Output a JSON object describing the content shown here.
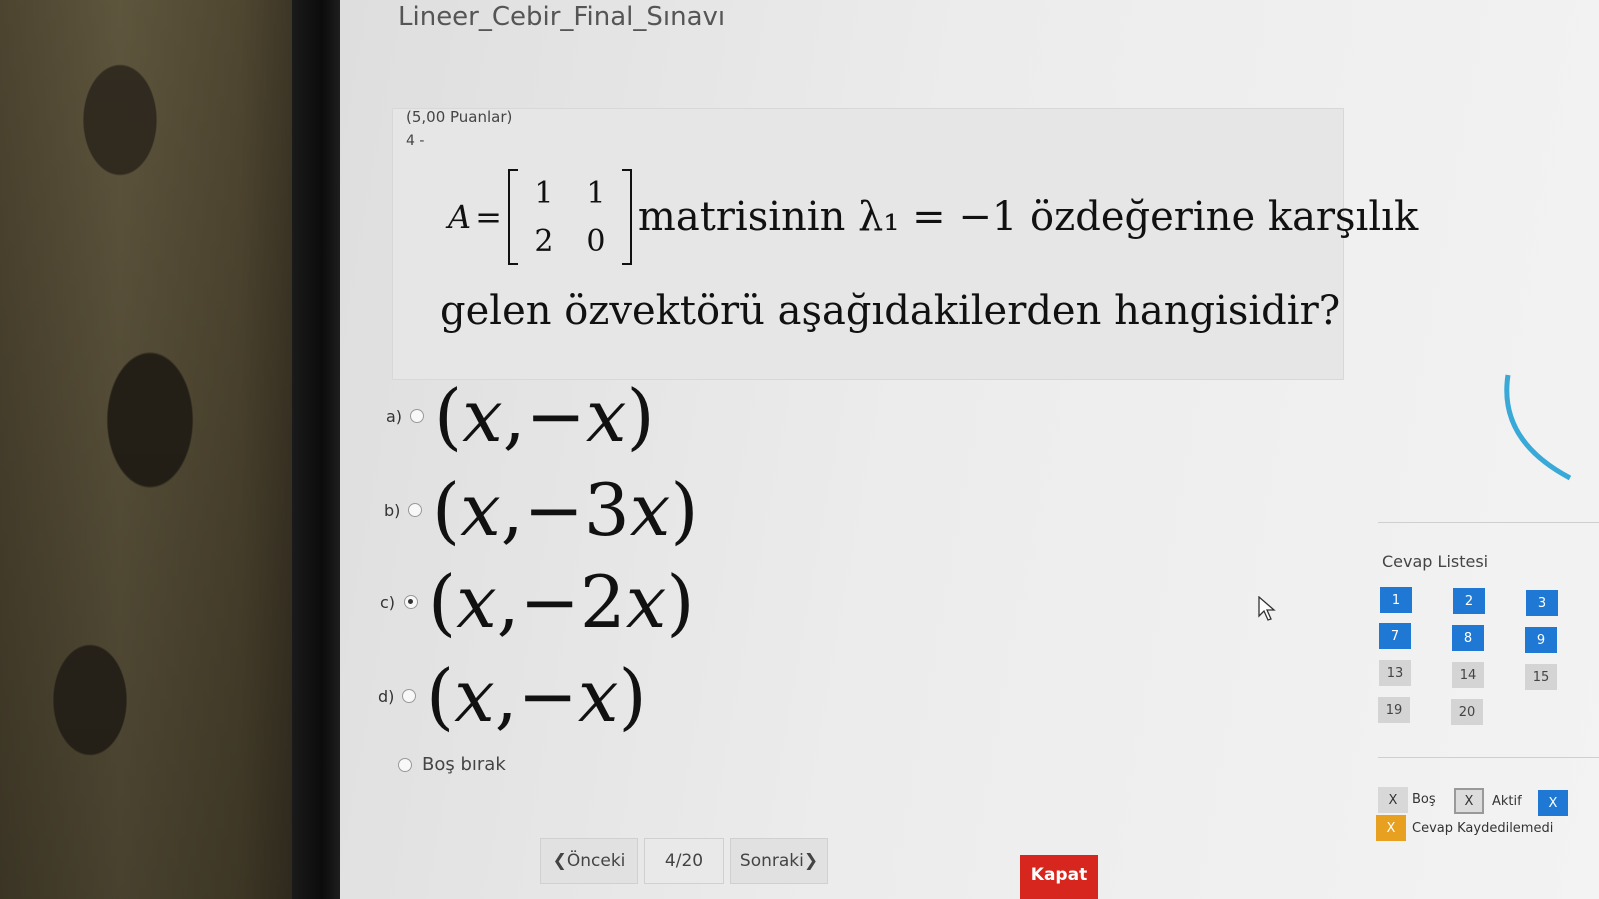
{
  "exam": {
    "title": "Lineer_Cebir_Final_Sınavı"
  },
  "question": {
    "points": "(5,00 Puanlar)",
    "number": "4 -",
    "matrix_var": "A",
    "equals": "=",
    "matrix": [
      [
        "1",
        "1"
      ],
      [
        "2",
        "0"
      ]
    ],
    "text_line1": "matrisinin λ₁ = −1 özdeğerine karşılık",
    "text_line2": "gelen özvektörü aşağıdakilerden hangisidir?"
  },
  "options": [
    {
      "letter": "a)",
      "open": "(",
      "v1": "x",
      "sep": ",−",
      "v2": "x",
      "close": ")",
      "selected": false
    },
    {
      "letter": "b)",
      "open": "(",
      "v1": "x",
      "sep": ",−3",
      "v2": "x",
      "close": ")",
      "selected": false
    },
    {
      "letter": "c)",
      "open": "(",
      "v1": "x",
      "sep": ",−2",
      "v2": "x",
      "close": ")",
      "selected": true
    },
    {
      "letter": "d)",
      "open": "(",
      "v1": "x",
      "sep": ",−",
      "v2": "x",
      "close": ")",
      "selected": false
    }
  ],
  "skip_option": {
    "label": "Boş bırak"
  },
  "navigation": {
    "prev_label": "❮Önceki",
    "counter": "4/20",
    "next_label": "Sonraki❯",
    "close_label": "Kapat"
  },
  "answer_list": {
    "title": "Cevap Listesi",
    "items": [
      {
        "label": "1",
        "state": "answered"
      },
      {
        "label": "2",
        "state": "answered"
      },
      {
        "label": "3",
        "state": "answered"
      },
      {
        "label": "7",
        "state": "answered"
      },
      {
        "label": "8",
        "state": "answered"
      },
      {
        "label": "9",
        "state": "answered"
      },
      {
        "label": "13",
        "state": "empty"
      },
      {
        "label": "14",
        "state": "empty"
      },
      {
        "label": "15",
        "state": "empty"
      },
      {
        "label": "19",
        "state": "empty"
      },
      {
        "label": "20",
        "state": "empty"
      }
    ]
  },
  "legend": {
    "empty_mark": "X",
    "empty_label": "Boş",
    "active_mark": "X",
    "active_label": "Aktif",
    "answered_mark": "X",
    "not_saved_mark": "X",
    "not_saved_label": "Cevap Kaydedilemedi"
  },
  "colors": {
    "answered": "#1f79d4",
    "empty": "#d4d4d4",
    "not_saved": "#e8a020",
    "close": "#d7261e"
  }
}
